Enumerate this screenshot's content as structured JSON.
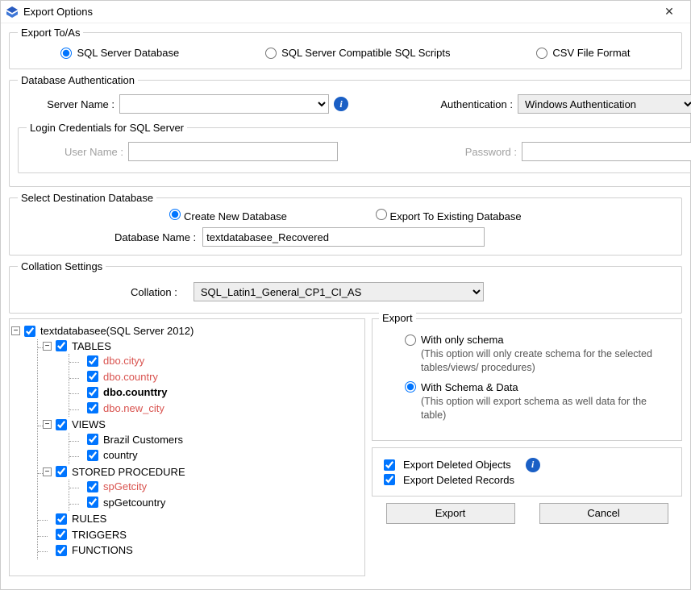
{
  "titlebar": {
    "title": "Export Options"
  },
  "exportTo": {
    "legend": "Export To/As",
    "options": {
      "sqlServer": "SQL Server Database",
      "scripts": "SQL Server Compatible SQL Scripts",
      "csv": "CSV File Format"
    },
    "selected": "sqlServer"
  },
  "dbAuth": {
    "legend": "Database Authentication",
    "serverNameLabel": "Server Name :",
    "serverName": "",
    "authLabel": "Authentication :",
    "authValue": "Windows Authentication"
  },
  "login": {
    "legend": "Login Credentials for SQL Server",
    "userLabel": "User Name :",
    "userValue": "",
    "passLabel": "Password :",
    "passValue": ""
  },
  "destDb": {
    "legend": "Select Destination Database",
    "createLabel": "Create New Database",
    "existingLabel": "Export To Existing Database",
    "selected": "create",
    "dbNameLabel": "Database Name :",
    "dbNameValue": "textdatabasee_Recovered"
  },
  "collation": {
    "legend": "Collation Settings",
    "label": "Collation :",
    "value": "SQL_Latin1_General_CP1_CI_AS"
  },
  "tree": {
    "root": "textdatabasee(SQL Server 2012)",
    "groups": {
      "tables": "TABLES",
      "views": "VIEWS",
      "sp": "STORED PROCEDURE",
      "rules": "RULES",
      "triggers": "TRIGGERS",
      "functions": "FUNCTIONS"
    },
    "tables": [
      {
        "label": "dbo.cityy",
        "style": "red"
      },
      {
        "label": "dbo.country",
        "style": "red"
      },
      {
        "label": "dbo.counttry",
        "style": "bold"
      },
      {
        "label": "dbo.new_city",
        "style": "red"
      }
    ],
    "views": [
      {
        "label": "Brazil Customers",
        "style": ""
      },
      {
        "label": "country",
        "style": ""
      }
    ],
    "sp": [
      {
        "label": "spGetcity",
        "style": "red"
      },
      {
        "label": "spGetcountry",
        "style": ""
      }
    ]
  },
  "export": {
    "legend": "Export",
    "schemaOnly": {
      "label": "With only schema",
      "hint": "(This option will only create schema for the  selected tables/views/ procedures)"
    },
    "schemaData": {
      "label": "With Schema & Data",
      "hint": "(This option will export schema as well data for the table)"
    },
    "selected": "schemaData",
    "deletedObjects": "Export Deleted Objects",
    "deletedRecords": "Export Deleted Records"
  },
  "buttons": {
    "export": "Export",
    "cancel": "Cancel"
  }
}
